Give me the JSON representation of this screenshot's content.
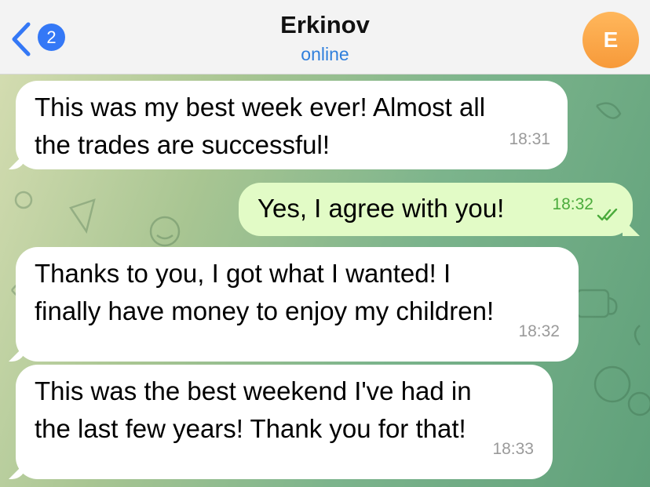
{
  "header": {
    "back_count": "2",
    "contact_name": "Erkinov",
    "contact_status": "online",
    "avatar_initial": "E"
  },
  "messages": [
    {
      "direction": "incoming",
      "text": "This was my best week ever! Almost all\nthe trades are successful!",
      "time": "18:31"
    },
    {
      "direction": "outgoing",
      "text": "Yes, I agree with you!",
      "time": "18:32",
      "read": true
    },
    {
      "direction": "incoming",
      "text": "Thanks to you, I got what I wanted! I\nfinally have money to enjoy my children!",
      "time": "18:32"
    },
    {
      "direction": "incoming",
      "text": "This was the best weekend I've had in\nthe last few years! Thank you for that!",
      "time": "18:33"
    }
  ],
  "colors": {
    "accent": "#3478f6",
    "outgoing_bubble": "#e2fbc6",
    "avatar": "#f79a3a",
    "read_checks": "#4bab3c"
  }
}
